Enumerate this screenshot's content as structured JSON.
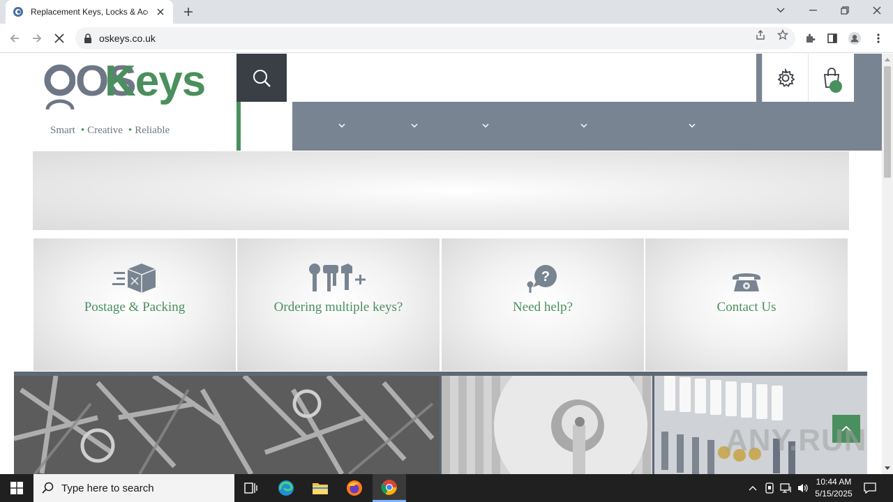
{
  "browser": {
    "tab_title": "Replacement Keys, Locks & Accessories",
    "url": "oskeys.co.uk"
  },
  "site": {
    "logo_prefix": "OS",
    "logo_suffix": "Keys",
    "tagline": [
      "Smart",
      "Creative",
      "Reliable"
    ],
    "brand_green": "#4a8f5e",
    "brand_gray": "#798492",
    "dark_gray": "#3a3f46",
    "cart_count": ""
  },
  "features": [
    {
      "label": "Postage & Packing",
      "icon": "delivery-box-icon"
    },
    {
      "label": "Ordering multiple keys?",
      "icon": "multiple-keys-icon"
    },
    {
      "label": "Need help?",
      "icon": "help-key-icon"
    },
    {
      "label": "Contact Us",
      "icon": "telephone-icon"
    }
  ],
  "taskbar": {
    "search_placeholder": "Type here to search",
    "time": "10:44 AM",
    "date": "5/15/2025"
  },
  "watermark": "ANY.RUN"
}
